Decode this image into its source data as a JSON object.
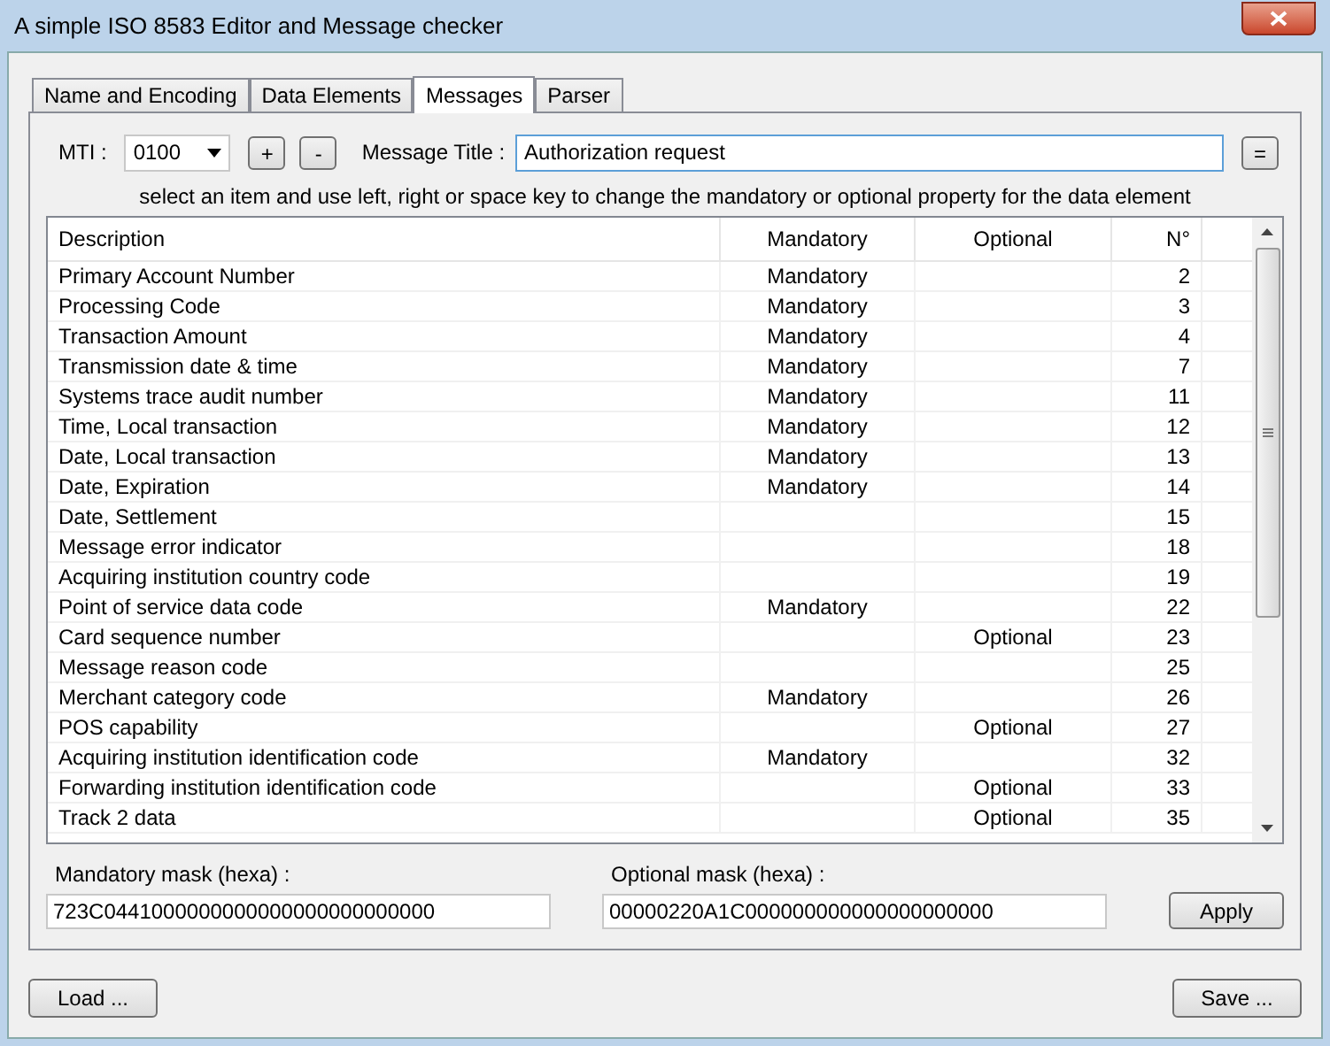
{
  "window": {
    "title": "A simple ISO 8583 Editor and Message checker"
  },
  "tabs": [
    {
      "label": "Name and Encoding",
      "selected": false
    },
    {
      "label": "Data Elements",
      "selected": false
    },
    {
      "label": "Messages",
      "selected": true
    },
    {
      "label": "Parser",
      "selected": false
    }
  ],
  "mti": {
    "label": "MTI :",
    "value": "0100"
  },
  "add_button": "+",
  "remove_button": "-",
  "message_title": {
    "label": "Message Title :",
    "value": "Authorization request"
  },
  "equals_button": "=",
  "hint": "select an item and use left, right or space key to change the mandatory or optional property for the data element",
  "table": {
    "columns": [
      "Description",
      "Mandatory",
      "Optional",
      "N°"
    ],
    "rows": [
      {
        "description": "Primary Account Number",
        "mandatory": "Mandatory",
        "number": "2"
      },
      {
        "description": "Processing Code",
        "mandatory": "Mandatory",
        "number": "3"
      },
      {
        "description": "Transaction Amount",
        "mandatory": "Mandatory",
        "number": "4"
      },
      {
        "description": "Transmission date & time",
        "mandatory": "Mandatory",
        "number": "7"
      },
      {
        "description": "Systems trace audit number",
        "mandatory": "Mandatory",
        "number": "11"
      },
      {
        "description": "Time, Local transaction",
        "mandatory": "Mandatory",
        "number": "12"
      },
      {
        "description": "Date, Local transaction",
        "mandatory": "Mandatory",
        "number": "13"
      },
      {
        "description": "Date, Expiration",
        "mandatory": "Mandatory",
        "number": "14"
      },
      {
        "description": "Date, Settlement",
        "number": "15"
      },
      {
        "description": "Message error indicator",
        "number": "18"
      },
      {
        "description": "Acquiring institution country code",
        "number": "19"
      },
      {
        "description": "Point of service data code",
        "mandatory": "Mandatory",
        "number": "22"
      },
      {
        "description": "Card sequence number",
        "optional": "Optional",
        "number": "23"
      },
      {
        "description": "Message reason code",
        "number": "25"
      },
      {
        "description": "Merchant category code",
        "mandatory": "Mandatory",
        "number": "26"
      },
      {
        "description": "POS capability",
        "optional": "Optional",
        "number": "27"
      },
      {
        "description": "Acquiring institution identification code",
        "mandatory": "Mandatory",
        "number": "32"
      },
      {
        "description": "Forwarding institution identification code",
        "optional": "Optional",
        "number": "33"
      },
      {
        "description": "Track 2 data",
        "optional": "Optional",
        "number": "35"
      }
    ]
  },
  "mandatory_mask": {
    "label": "Mandatory mask (hexa) :",
    "value": "723C0441000000000000000000000000"
  },
  "optional_mask": {
    "label": "Optional mask (hexa) :",
    "value": "00000220A1C000000000000000000000"
  },
  "apply_button": "Apply",
  "load_button": "Load ...",
  "save_button": "Save ..."
}
